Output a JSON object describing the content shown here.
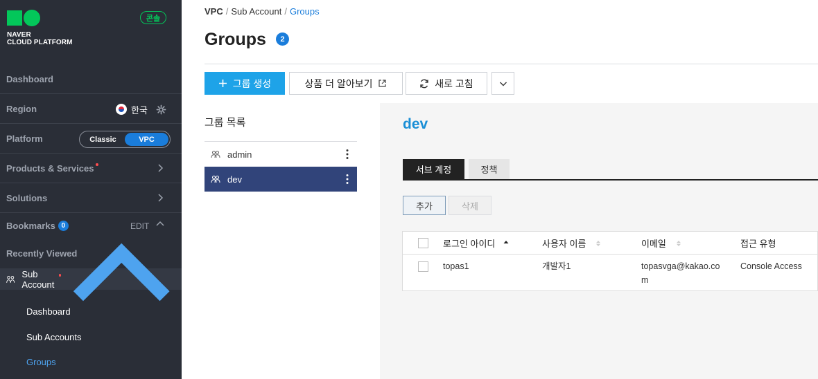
{
  "app": {
    "logo_line1": "NAVER",
    "logo_line2": "CLOUD PLATFORM",
    "console_label": "콘솔"
  },
  "sidebar": {
    "dashboard": "Dashboard",
    "region_label": "Region",
    "region_value": "한국",
    "platform_label": "Platform",
    "platform_options": [
      "Classic",
      "VPC"
    ],
    "platform_selected": "VPC",
    "products": "Products & Services",
    "solutions": "Solutions",
    "bookmarks": "Bookmarks",
    "bookmarks_count": "0",
    "bookmarks_edit": "EDIT",
    "recently_viewed": "Recently Viewed",
    "sub_account": "Sub Account",
    "sub_items": [
      "Dashboard",
      "Sub Accounts",
      "Groups"
    ],
    "active_sub_item": "Groups"
  },
  "breadcrumb": [
    "VPC",
    "Sub Account",
    "Groups"
  ],
  "page": {
    "title": "Groups",
    "count": "2"
  },
  "toolbar": {
    "create_label": "그룹 생성",
    "learn_more_label": "상품 더 알아보기",
    "refresh_label": "새로 고침"
  },
  "groups": {
    "panel_title": "그룹 목록",
    "items": [
      "admin",
      "dev"
    ],
    "selected": "dev"
  },
  "detail": {
    "title": "dev",
    "tabs": [
      "서브 계정",
      "정책"
    ],
    "active_tab": "서브 계정",
    "add_label": "추가",
    "delete_label": "삭제",
    "columns": [
      "로그인 아이디",
      "사용자 이름",
      "이메일",
      "접근 유형"
    ],
    "rows": [
      {
        "login_id": "topas1",
        "user_name": "개발자1",
        "email_line1": "topasvga@kakao.co",
        "email_line2": "m",
        "access_type": "Console Access"
      }
    ]
  },
  "colors": {
    "sidebar_bg": "#2a2e37",
    "brand_green": "#03c75a",
    "primary_blue": "#1ea3e8",
    "selected_group": "#31447a",
    "accent_blue": "#1a7ddb"
  }
}
